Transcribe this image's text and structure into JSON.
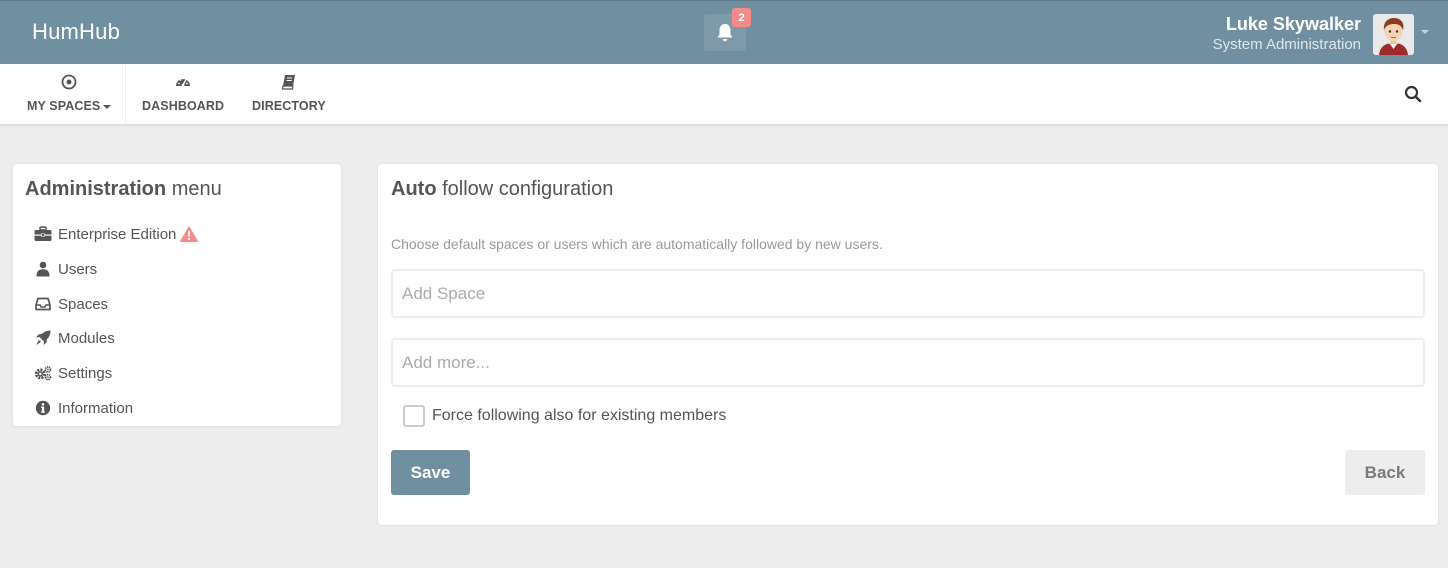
{
  "app": {
    "brand": "HumHub",
    "colors": {
      "primary": "#708fa0",
      "warning": "#fc4a64",
      "background": "#ededed"
    }
  },
  "topbar": {
    "notifications": {
      "icon": "bell-icon",
      "count": "2"
    },
    "user": {
      "name": "Luke Skywalker",
      "role": "System Administration",
      "avatar_icon": "user-avatar"
    }
  },
  "nav": {
    "items": [
      {
        "label": "MY SPACES",
        "icon": "dot-circle-icon"
      },
      {
        "label": "DASHBOARD",
        "icon": "tachometer-icon"
      },
      {
        "label": "DIRECTORY",
        "icon": "book-icon"
      }
    ],
    "search_icon": "search-icon"
  },
  "admin_menu": {
    "title_bold": "Administration",
    "title_light": "menu",
    "items": [
      {
        "label": "Enterprise Edition",
        "icon": "briefcase-icon",
        "warning_icon": "warning-icon"
      },
      {
        "label": "Users",
        "icon": "user-icon"
      },
      {
        "label": "Spaces",
        "icon": "inbox-icon"
      },
      {
        "label": "Modules",
        "icon": "rocket-icon"
      },
      {
        "label": "Settings",
        "icon": "cogs-icon"
      },
      {
        "label": "Information",
        "icon": "info-circle-icon"
      }
    ]
  },
  "content": {
    "title_bold": "Auto",
    "title_light": "follow configuration",
    "help_text": "Choose default spaces or users which are automatically followed by new users.",
    "space_placeholder": "Add Space",
    "more_placeholder": "Add more...",
    "checkbox_label": "Force following also for existing members",
    "checkbox_checked": false,
    "save_label": "Save",
    "back_label": "Back"
  }
}
